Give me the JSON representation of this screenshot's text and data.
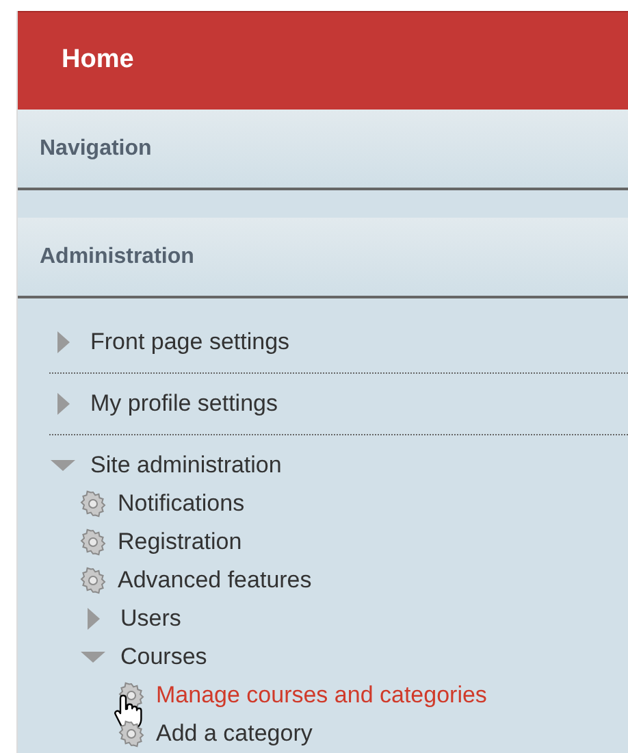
{
  "header": {
    "title": "Home"
  },
  "blocks": [
    {
      "title": "Navigation"
    },
    {
      "title": "Administration"
    }
  ],
  "tree": [
    {
      "kind": "branch",
      "label": "Front page settings",
      "expanded": false
    },
    {
      "kind": "branch",
      "label": "My profile settings",
      "expanded": false
    },
    {
      "kind": "branch",
      "label": "Site administration",
      "expanded": true,
      "children": [
        {
          "kind": "leaf",
          "label": "Notifications",
          "hovered": false
        },
        {
          "kind": "leaf",
          "label": "Registration",
          "hovered": false
        },
        {
          "kind": "leaf",
          "label": "Advanced features",
          "hovered": false
        },
        {
          "kind": "branch",
          "label": "Users",
          "expanded": false
        },
        {
          "kind": "branch",
          "label": "Courses",
          "expanded": true,
          "children": [
            {
              "kind": "leaf",
              "label": "Manage courses and categories",
              "hovered": true
            },
            {
              "kind": "leaf",
              "label": "Add a category",
              "hovered": false
            }
          ]
        }
      ]
    }
  ]
}
